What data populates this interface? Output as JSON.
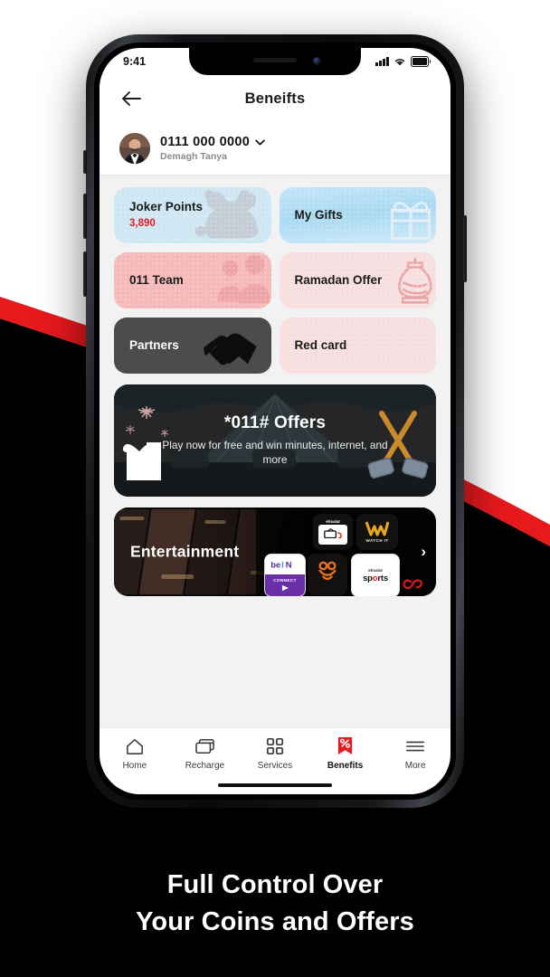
{
  "status_bar": {
    "time": "9:41",
    "signal_icon": "signal-bars-icon",
    "wifi_icon": "wifi-icon",
    "battery_icon": "battery-full-icon"
  },
  "header": {
    "title": "Beneifts",
    "back_icon": "back-arrow-icon"
  },
  "profile": {
    "avatar_icon": "user-avatar",
    "msisdn": "0111 000 0000",
    "chevron_icon": "chevron-down-icon",
    "name": "Demagh Tanya"
  },
  "tiles": [
    {
      "label": "Joker Points",
      "value": "3,890",
      "art": "jester-hat-icon",
      "theme": "t-blue"
    },
    {
      "label": "My Gifts",
      "value": "",
      "art": "gift-box-icon",
      "theme": "t-blue2"
    },
    {
      "label": "011 Team",
      "value": "",
      "art": "team-icon",
      "theme": "t-pink"
    },
    {
      "label": "Ramadan Offer",
      "value": "",
      "art": "lantern-icon",
      "theme": "t-pink2"
    },
    {
      "label": "Partners",
      "value": "",
      "art": "handshake-icon",
      "theme": "t-dark"
    },
    {
      "label": "Red card",
      "value": "",
      "art": "",
      "theme": "t-pink2"
    }
  ],
  "offers_banner": {
    "title": "*011# Offers",
    "subtitle": "Play now for free and win minutes, internet, and more",
    "left_art": "gift-and-firework-icon",
    "right_art": "carnival-mallets-icon"
  },
  "entertainment": {
    "title": "Entertainment",
    "arrow_icon": "chevron-right-icon",
    "brand_icon": "e-and-logo",
    "logos": [
      {
        "name": "etisalat TV",
        "sub": "etisalat"
      },
      {
        "name": "WATCH IT",
        "sub": "WATCH IT"
      },
      {
        "name": "beIN CONNECT",
        "sub": "CONNECT"
      },
      {
        "name": "Mixing",
        "sub": ""
      },
      {
        "name": "etisalat sports",
        "sub": "etisalat"
      }
    ]
  },
  "bottom_nav": {
    "items": [
      {
        "label": "Home",
        "icon": "home-icon",
        "active": false
      },
      {
        "label": "Recharge",
        "icon": "recharge-cards-icon",
        "active": false
      },
      {
        "label": "Services",
        "icon": "grid-squares-icon",
        "active": false
      },
      {
        "label": "Benefits",
        "icon": "percent-badge-icon",
        "active": true
      },
      {
        "label": "More",
        "icon": "hamburger-menu-icon",
        "active": false
      }
    ]
  },
  "caption": {
    "line1": "Full Control Over",
    "line2": "Your Coins and  Offers"
  },
  "colors": {
    "brand_red": "#e8191d",
    "tile_blue": "#cfe7f3",
    "tile_pink": "#f5b9b9",
    "tile_pink_light": "#f7dfe0",
    "tile_dark": "#4c4c4c",
    "screen_bg": "#f2f2f2"
  }
}
